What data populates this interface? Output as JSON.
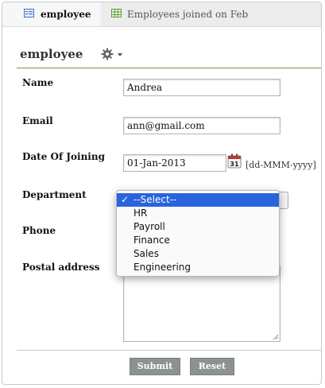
{
  "tabs": [
    {
      "label": "employee",
      "icon": "form-icon"
    },
    {
      "label": "Employees joined on Feb",
      "icon": "table-icon"
    }
  ],
  "form": {
    "title": "employee",
    "fields": {
      "name": {
        "label": "Name",
        "value": "Andrea"
      },
      "email": {
        "label": "Email",
        "value": "ann@gmail.com"
      },
      "doj": {
        "label": "Date Of Joining",
        "value": "01-Jan-2013",
        "format_hint": "[dd-MMM-yyyy]",
        "calendar_day": "31"
      },
      "department": {
        "label": "Department",
        "selected": "--Select--"
      },
      "phone": {
        "label": "Phone",
        "value": ""
      },
      "postal": {
        "label": "Postal address",
        "value": ""
      }
    }
  },
  "dropdown": {
    "options": [
      "--Select--",
      "HR",
      "Payroll",
      "Finance",
      "Sales",
      "Engineering"
    ],
    "check_mark": "✓"
  },
  "buttons": {
    "submit": "Submit",
    "reset": "Reset"
  },
  "colors": {
    "selection": "#2a63de",
    "button": "#8c9192",
    "rule": "#8a8a55"
  }
}
